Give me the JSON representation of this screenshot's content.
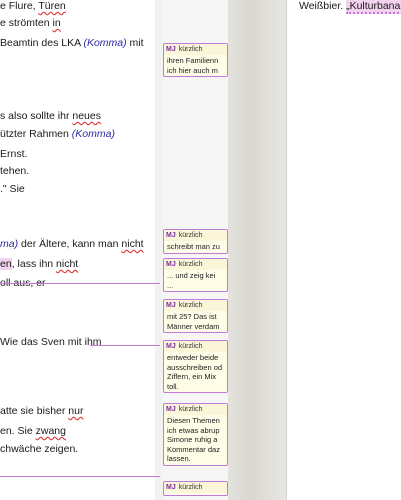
{
  "document": {
    "lines": [
      {
        "parts": [
          {
            "t": "e Flure, "
          },
          {
            "t": "Türen",
            "u": "sq"
          }
        ]
      },
      {
        "parts": [
          {
            "t": "e strömten "
          },
          {
            "t": "in",
            "u": "sq"
          }
        ]
      },
      {
        "parts": [
          {
            "t": " Beamtin des LKA "
          },
          {
            "t": "(Komma)",
            "c": "comma"
          },
          {
            "t": " mit"
          }
        ]
      },
      {
        "parts": [
          {
            "t": "s also sollte ihr "
          },
          {
            "t": "neues",
            "u": "sq"
          }
        ]
      },
      {
        "parts": [
          {
            "t": "ützter Rahmen "
          },
          {
            "t": "(Komma)",
            "c": "comma"
          }
        ]
      },
      {
        "parts": [
          {
            "t": " Ernst."
          }
        ]
      },
      {
        "parts": [
          {
            "t": "tehen."
          }
        ]
      },
      {
        "parts": [
          {
            "t": ".\" Sie"
          }
        ]
      },
      {
        "parts": [
          {
            "t": "ma)",
            "c": "comma"
          },
          {
            "t": " der Ältere, kann man "
          },
          {
            "t": "nicht",
            "u": "sq"
          }
        ]
      },
      {
        "parts": [
          {
            "t": "en",
            "c": "hl"
          },
          {
            "t": ", lass ihn "
          },
          {
            "t": "nicht",
            "u": "sq"
          }
        ]
      },
      {
        "parts": [
          {
            "t": "oll aus, er"
          }
        ]
      },
      {
        "parts": [
          {
            "t": "Wie das Sven mit ihm"
          }
        ]
      },
      {
        "parts": [
          {
            "t": "atte sie bisher "
          },
          {
            "t": "nur",
            "u": "sq"
          }
        ]
      },
      {
        "parts": [
          {
            "t": "en. Sie "
          },
          {
            "t": "zwang",
            "u": "sq"
          }
        ]
      },
      {
        "parts": [
          {
            "t": "chwäche zeigen."
          }
        ]
      }
    ]
  },
  "comments": [
    {
      "initials": "MJ",
      "time": "kürzlich",
      "lines": [
        "ihren Familienn",
        "ich hier auch m"
      ]
    },
    {
      "initials": "MJ",
      "time": "kürzlich",
      "lines": [
        "schreibt man zu"
      ]
    },
    {
      "initials": "MJ",
      "time": "kürzlich",
      "lines": [
        "... und zeig kei",
        "..."
      ]
    },
    {
      "initials": "MJ",
      "time": "kürzlich",
      "lines": [
        "mit 25? Das ist",
        "Männer verdam"
      ]
    },
    {
      "initials": "MJ",
      "time": "kürzlich",
      "lines": [
        "entweder beide",
        "ausschreiben od",
        "Ziffern, ein Mix",
        "toll."
      ]
    },
    {
      "initials": "MJ",
      "time": "kürzlich",
      "lines": [
        "Diesen Themen",
        "ich etwas abrup",
        "Simone ruhig a",
        "Kommentar daz",
        "lassen."
      ]
    },
    {
      "initials": "MJ",
      "time": "kürzlich",
      "lines": []
    }
  ],
  "page2": {
    "lines": [
      {
        "parts": [
          {
            "t": "Weißbier. "
          },
          {
            "t": "„Kulturbanau",
            "c": "hl2"
          }
        ]
      }
    ]
  }
}
